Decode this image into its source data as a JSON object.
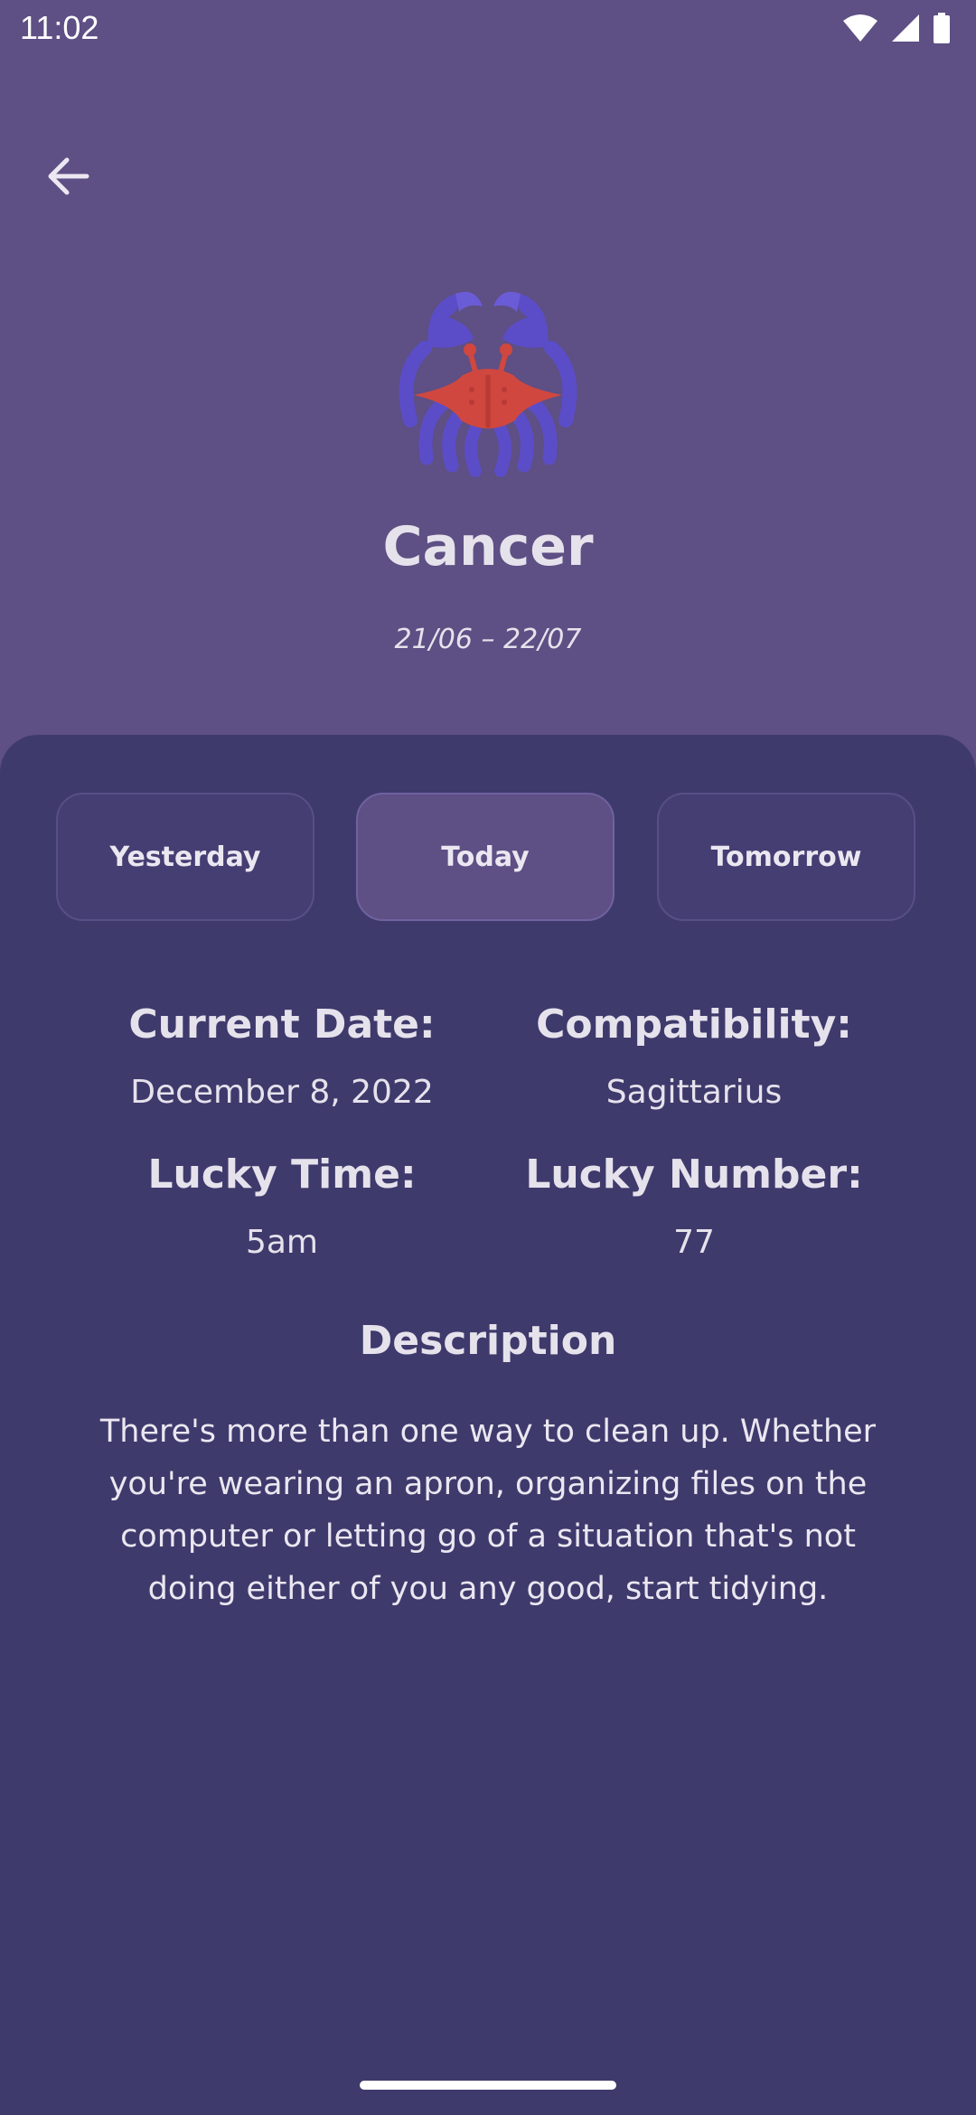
{
  "status": {
    "time": "11:02"
  },
  "sign": {
    "name": "Cancer",
    "dates": "21/06 – 22/07",
    "icon": "crab-icon"
  },
  "tabs": [
    {
      "label": "Yesterday",
      "active": false
    },
    {
      "label": "Today",
      "active": true
    },
    {
      "label": "Tomorrow",
      "active": false
    }
  ],
  "info": {
    "current_date_label": "Current Date:",
    "current_date_value": "December 8, 2022",
    "compatibility_label": "Compatibility:",
    "compatibility_value": "Sagittarius",
    "lucky_time_label": "Lucky Time:",
    "lucky_time_value": "5am",
    "lucky_number_label": "Lucky Number:",
    "lucky_number_value": "77"
  },
  "description": {
    "title": "Description",
    "text": "There's more than one way to clean up. Whether you're wearing an apron, organizing files on the computer or letting go of a situation that's not doing either of you any good, start tidying."
  },
  "colors": {
    "header_bg": "#5e4f84",
    "panel_bg": "#3f3a6c",
    "active_tab": "#5e4f85",
    "crab_claws": "#5b4dc8",
    "crab_body": "#d0473f"
  }
}
